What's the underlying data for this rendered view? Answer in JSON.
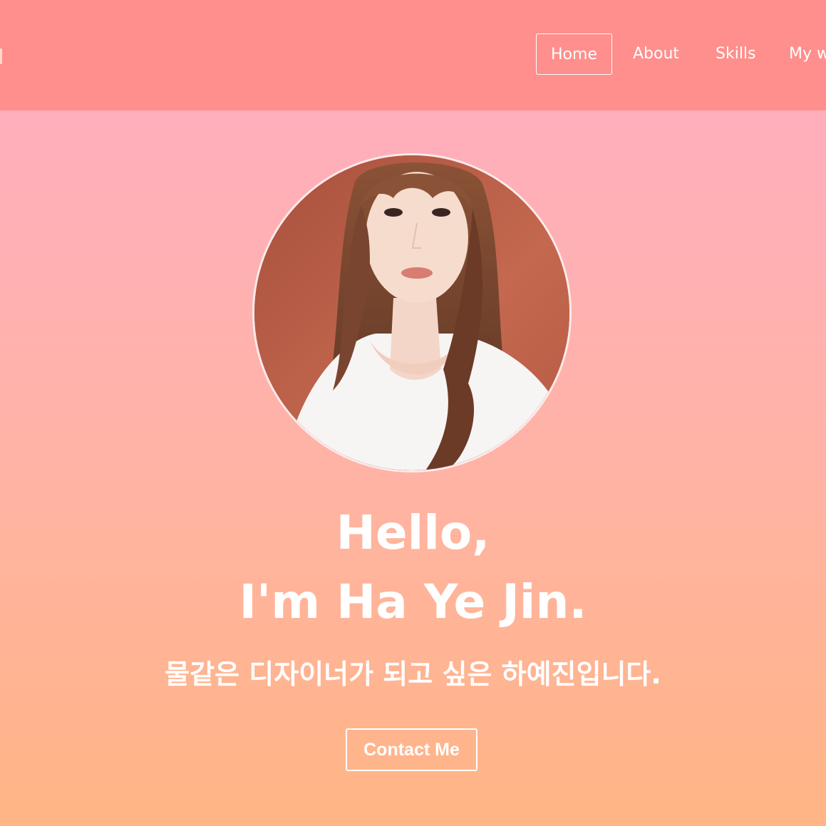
{
  "nav": {
    "items": [
      {
        "label": "Home",
        "active": true
      },
      {
        "label": "About",
        "active": false
      },
      {
        "label": "Skills",
        "active": false
      },
      {
        "label": "My w",
        "active": false
      }
    ]
  },
  "hero": {
    "greeting": "Hello,",
    "name_line": "I'm Ha Ye Jin.",
    "subtitle": "물같은 디자이너가 되고 싶은 하예진입니다.",
    "cta_label": "Contact Me"
  },
  "colors": {
    "navbar": "#ff8f8c",
    "gradient_top": "#ffaebc",
    "gradient_bottom": "#ffb585",
    "text": "#ffffff"
  },
  "icons": {
    "avatar": "profile-photo"
  }
}
